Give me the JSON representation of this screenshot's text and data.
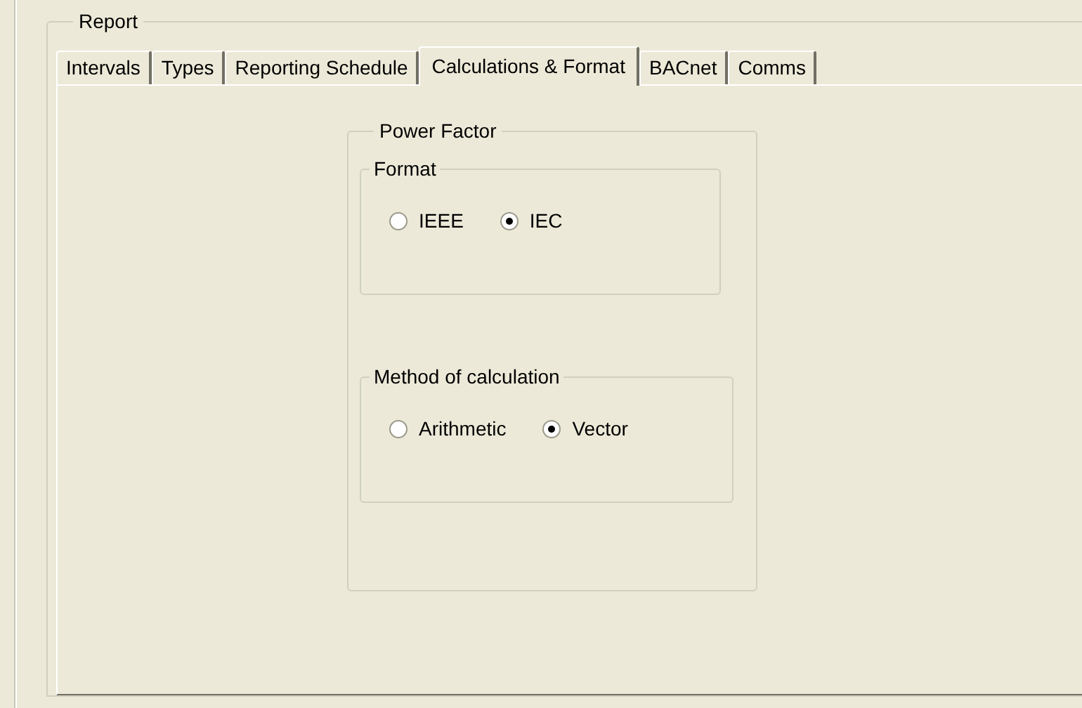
{
  "report": {
    "title": "Report"
  },
  "tabs": [
    {
      "label": "Intervals",
      "selected": false
    },
    {
      "label": "Types",
      "selected": false
    },
    {
      "label": "Reporting Schedule",
      "selected": false
    },
    {
      "label": "Calculations & Format",
      "selected": true
    },
    {
      "label": "BACnet",
      "selected": false
    },
    {
      "label": "Comms",
      "selected": false
    }
  ],
  "power_factor": {
    "title": "Power Factor",
    "groups": [
      {
        "title": "Format",
        "options": [
          {
            "label": "IEEE",
            "selected": false
          },
          {
            "label": "IEC",
            "selected": true
          }
        ]
      },
      {
        "title": "Method of calculation",
        "options": [
          {
            "label": "Arithmetic",
            "selected": false
          },
          {
            "label": "Vector",
            "selected": true
          }
        ]
      }
    ]
  }
}
